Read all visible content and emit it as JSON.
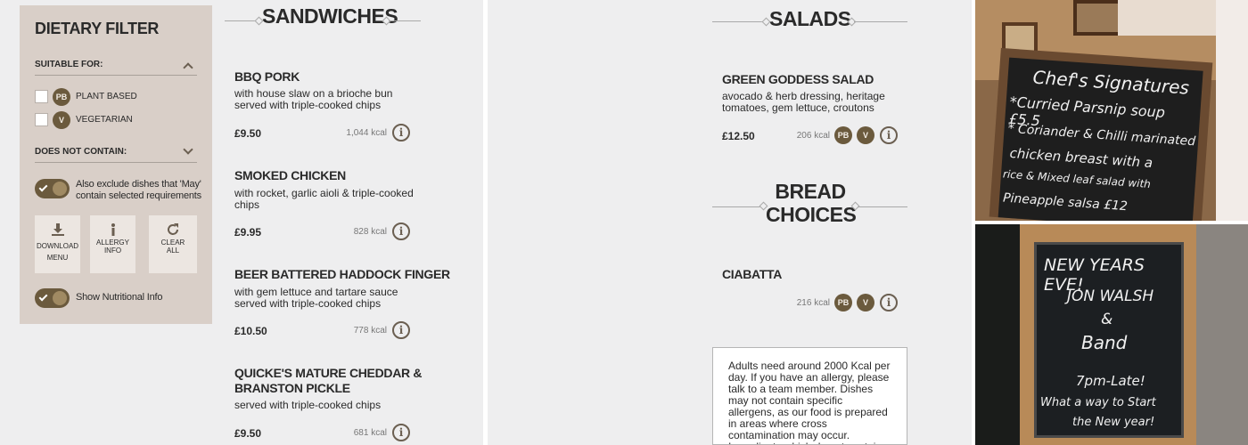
{
  "filter": {
    "title": "DIETARY FILTER",
    "suitable_label": "SUITABLE FOR:",
    "options": [
      {
        "code": "PB",
        "label": "PLANT BASED"
      },
      {
        "code": "V",
        "label": "VEGETARIAN"
      }
    ],
    "not_contain_label": "DOES NOT CONTAIN:",
    "exclude_may_line1": "Also exclude dishes that 'May'",
    "exclude_may_line2": "contain selected requirements",
    "buttons": {
      "download_l1": "DOWNLOAD",
      "download_l2": "MENU",
      "allergy_l1": "ALLERGY",
      "allergy_l2": "INFO",
      "clear_l1": "CLEAR",
      "clear_l2": "ALL"
    },
    "nutrition_label": "Show Nutritional Info"
  },
  "sandwiches": {
    "heading": "SANDWICHES",
    "items": [
      {
        "name": "BBQ PORK",
        "desc1": "with house slaw on a brioche bun",
        "desc2": "served with triple-cooked chips",
        "price": "£9.50",
        "kcal": "1,044 kcal"
      },
      {
        "name": "SMOKED CHICKEN",
        "desc1": "with rocket, garlic aioli & triple-cooked",
        "desc2": "chips",
        "price": "£9.95",
        "kcal": "828 kcal"
      },
      {
        "name": "BEER BATTERED HADDOCK FINGER",
        "desc1": "with gem lettuce and tartare sauce",
        "desc2": "served with triple-cooked chips",
        "price": "£10.50",
        "kcal": "778 kcal"
      },
      {
        "name1": "QUICKE'S MATURE CHEDDAR &",
        "name2": "BRANSTON PICKLE",
        "desc1": "served with triple-cooked chips",
        "price": "£9.50",
        "kcal": "681 kcal"
      }
    ]
  },
  "salads": {
    "heading": "SALADS",
    "item": {
      "name": "GREEN GODDESS SALAD",
      "desc1": "avocado & herb dressing, heritage",
      "desc2": "tomatoes, gem lettuce, croutons",
      "price": "£12.50",
      "kcal": "206 kcal",
      "badges": [
        "PB",
        "V"
      ]
    }
  },
  "bread": {
    "heading1": "BREAD",
    "heading2": "CHOICES",
    "item": {
      "name": "CIABATTA",
      "kcal": "216 kcal",
      "badges": [
        "PB",
        "V"
      ]
    }
  },
  "note": {
    "text": "Adults need around 2000 Kcal per day. If you have an allergy, please talk to a team member. Dishes may not contain specific allergens, as our food is prepared in areas where cross contamination may occur. Ingredients which do not contain"
  },
  "photos": {
    "top": {
      "line1": "Chef's Signatures",
      "line2": "*Curried Parsnip soup £5.5",
      "line3": "* Coriander & Chilli marinated",
      "line4": "chicken breast with a",
      "line5": "rice & Mixed leaf salad with",
      "line6": "Pineapple salsa £12"
    },
    "bottom": {
      "line1": "NEW YEARS EVE!",
      "line2": "JON WALSH",
      "line3": "&",
      "line4": "Band",
      "line5": "7pm-Late!",
      "line6": "What a way to Start",
      "line7": "the New year!"
    }
  },
  "icons": {
    "info": "i"
  },
  "colors": {
    "panel": "#d9cfc8",
    "accent": "#6b5a3d",
    "background": "#eeeeef"
  }
}
